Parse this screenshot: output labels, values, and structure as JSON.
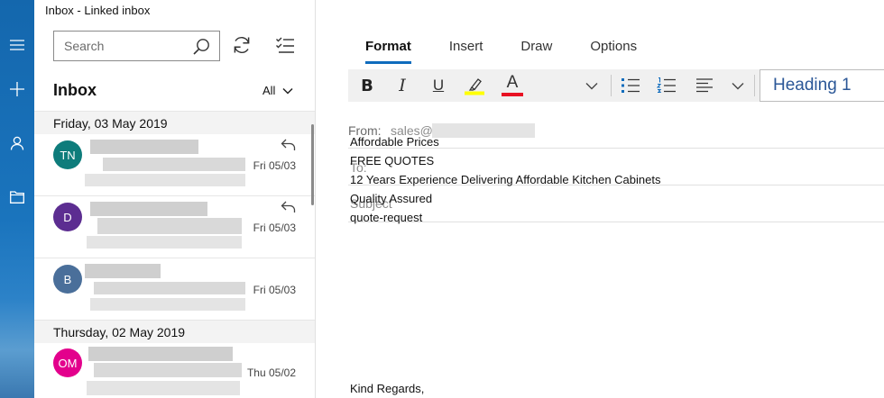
{
  "window": {
    "title": "Inbox - Linked inbox"
  },
  "rail": {
    "icons": [
      "hamburger-menu-icon",
      "new-mail-icon",
      "person-icon",
      "folder-icon"
    ],
    "colors": {
      "top": "#1467ad",
      "bottom": "#3a78b0"
    }
  },
  "search": {
    "placeholder": "Search"
  },
  "folder": {
    "title": "Inbox",
    "filter": "All"
  },
  "groups": [
    {
      "date": "Friday, 03 May 2019"
    },
    {
      "date": "Thursday, 02 May 2019"
    }
  ],
  "messages": [
    {
      "initials": "TN",
      "date": "Fri 05/03",
      "avatar_color": "#0e7c7b",
      "replied": true
    },
    {
      "initials": "D",
      "date": "Fri 05/03",
      "avatar_color": "#5c2d91",
      "replied": true
    },
    {
      "initials": "B",
      "date": "Fri 05/03",
      "avatar_color": "#4a6f9a",
      "replied": false
    },
    {
      "initials": "OM",
      "date": "Thu 05/02",
      "avatar_color": "#e3008c",
      "replied": false
    }
  ],
  "tabs": [
    {
      "label": "Format",
      "active": true
    },
    {
      "label": "Insert",
      "active": false
    },
    {
      "label": "Draw",
      "active": false
    },
    {
      "label": "Options",
      "active": false
    }
  ],
  "ribbon": {
    "bold": "B",
    "italic": "I",
    "underline": "U",
    "font_color_letter": "A",
    "highlight_color": "#ffff00",
    "font_color": "#e81123",
    "style": "Heading 1"
  },
  "compose": {
    "from_label": "From:",
    "from_value": "sales@",
    "to_label": "To:",
    "subject_label": "Subject",
    "body_lines": [
      "Affordable Prices",
      "FREE QUOTES",
      "12 Years Experience Delivering Affordable Kitchen Cabinets",
      "Quality Assured",
      "quote-request"
    ],
    "signoff": "Kind Regards,"
  },
  "accent": "#0f6cbd"
}
